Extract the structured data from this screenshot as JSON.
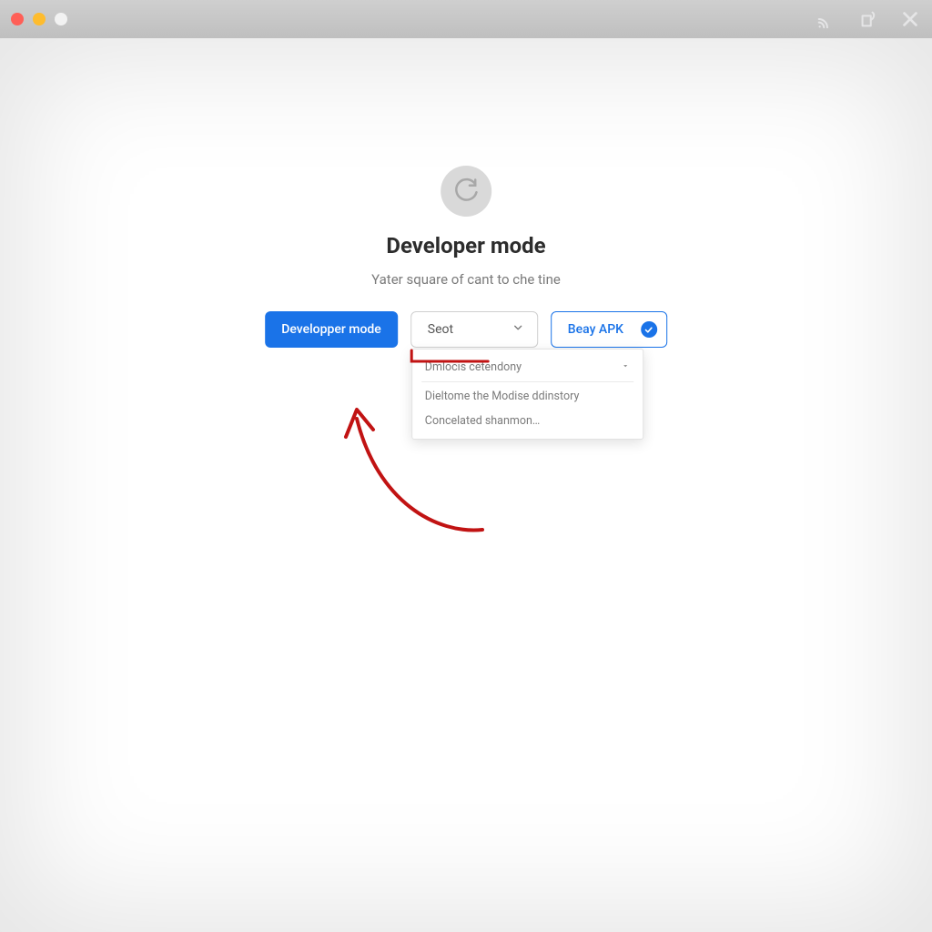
{
  "hero": {
    "title": "Developer mode",
    "subtitle": "Yater square of cant to che tine"
  },
  "buttons": {
    "primary_label": "Developper mode",
    "select_label": "Seot",
    "outline_label": "Beay APK"
  },
  "dropdown": {
    "item1": "Dmlocis cetendony",
    "item2": "Dieltome the Modise ddinstory",
    "item3": "Concelated shanmon…"
  }
}
